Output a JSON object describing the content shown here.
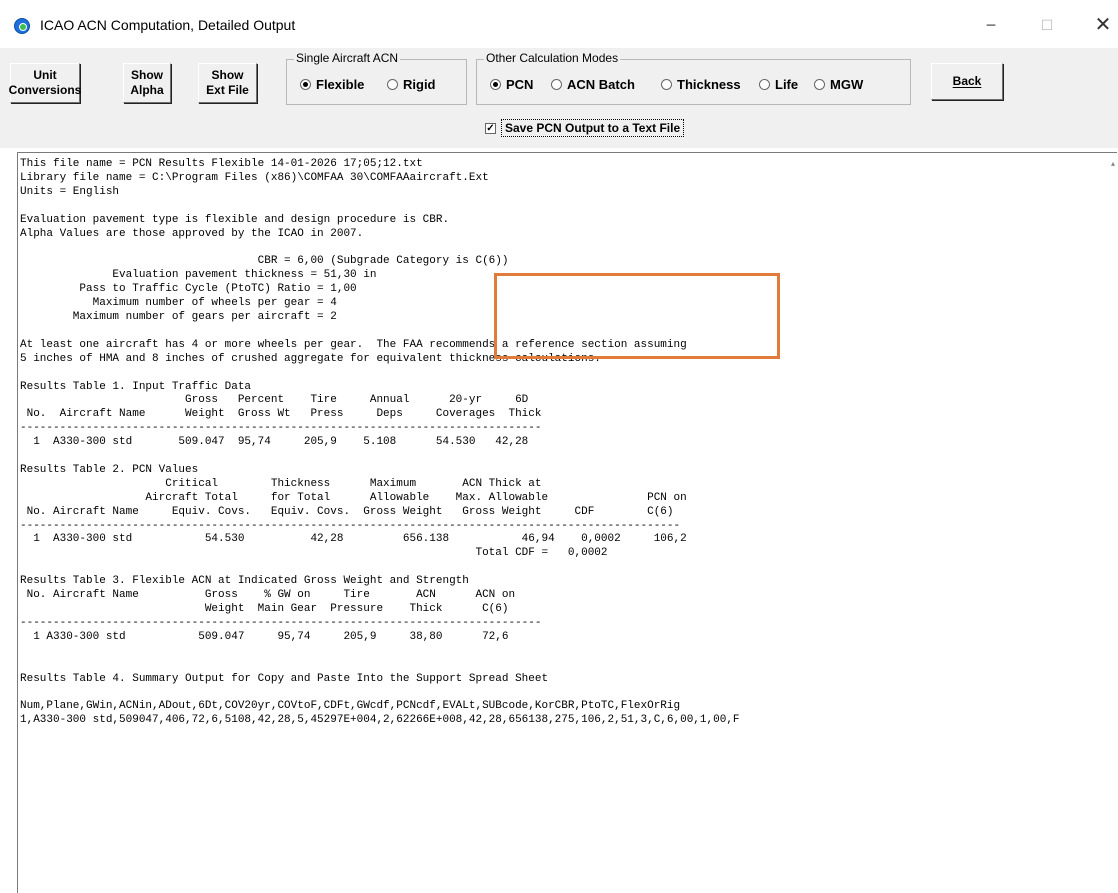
{
  "window": {
    "title": "ICAO ACN Computation, Detailed Output",
    "minimize_glyph": "−",
    "maximize_glyph": "☐",
    "close_glyph": "✕"
  },
  "toolbar": {
    "unit_conversions": "Unit\nConversions",
    "show_alpha": "Show\nAlpha",
    "show_ext_file": "Show\nExt File",
    "back": "Back",
    "single_aircraft_group": {
      "legend": "Single Aircraft ACN",
      "options": [
        {
          "label": "Flexible",
          "selected": true
        },
        {
          "label": "Rigid",
          "selected": false
        }
      ]
    },
    "other_modes_group": {
      "legend": "Other Calculation Modes",
      "options": [
        {
          "label": "PCN",
          "selected": true
        },
        {
          "label": "ACN Batch",
          "selected": false
        },
        {
          "label": "Thickness",
          "selected": false
        },
        {
          "label": "Life",
          "selected": false
        },
        {
          "label": "MGW",
          "selected": false
        }
      ]
    },
    "save_pcn_checkbox": {
      "label": "Save PCN Output to a Text File",
      "checked": true
    }
  },
  "output": {
    "lines": [
      "This file name = PCN Results Flexible 14-01-2026 17;05;12.txt",
      "Library file name = C:\\Program Files (x86)\\COMFAA 30\\COMFAAaircraft.Ext",
      "Units = English",
      "",
      "Evaluation pavement type is flexible and design procedure is CBR.",
      "Alpha Values are those approved by the ICAO in 2007.",
      "",
      "                                    CBR = 6,00 (Subgrade Category is C(6))",
      "              Evaluation pavement thickness = 51,30 in",
      "         Pass to Traffic Cycle (PtoTC) Ratio = 1,00",
      "           Maximum number of wheels per gear = 4",
      "        Maximum number of gears per aircraft = 2",
      "",
      "At least one aircraft has 4 or more wheels per gear.  The FAA recommends a reference section assuming",
      "5 inches of HMA and 8 inches of crushed aggregate for equivalent thickness calculations.",
      "",
      "Results Table 1. Input Traffic Data",
      "                         Gross   Percent    Tire     Annual      20-yr     6D",
      " No.  Aircraft Name      Weight  Gross Wt   Press     Deps     Coverages  Thick",
      "-------------------------------------------------------------------------------",
      "  1  A330-300 std       509.047  95,74     205,9    5.108      54.530   42,28",
      "",
      "Results Table 2. PCN Values",
      "                      Critical        Thickness      Maximum       ACN Thick at",
      "                   Aircraft Total     for Total      Allowable    Max. Allowable               PCN on",
      " No. Aircraft Name     Equiv. Covs.   Equiv. Covs.  Gross Weight   Gross Weight     CDF        C(6)",
      "----------------------------------------------------------------------------------------------------",
      "  1  A330-300 std           54.530          42,28         656.138           46,94    0,0002     106,2",
      "                                                                     Total CDF =   0,0002",
      "",
      "Results Table 3. Flexible ACN at Indicated Gross Weight and Strength",
      " No. Aircraft Name          Gross    % GW on     Tire       ACN      ACN on",
      "                            Weight  Main Gear  Pressure    Thick      C(6)",
      "-------------------------------------------------------------------------------",
      "  1 A330-300 std           509.047     95,74     205,9     38,80      72,6",
      "",
      "",
      "Results Table 4. Summary Output for Copy and Paste Into the Support Spread Sheet",
      "",
      "Num,Plane,GWin,ACNin,ADout,6Dt,COV20yr,COVtoF,CDFt,GWcdf,PCNcdf,EVALt,SUBcode,KorCBR,PtoTC,FlexOrRig",
      "1,A330-300 std,509047,406,72,6,5108,42,28,5,45297E+004,2,62266E+008,42,28,656138,275,106,2,51,3,C,6,00,1,00,F"
    ]
  }
}
